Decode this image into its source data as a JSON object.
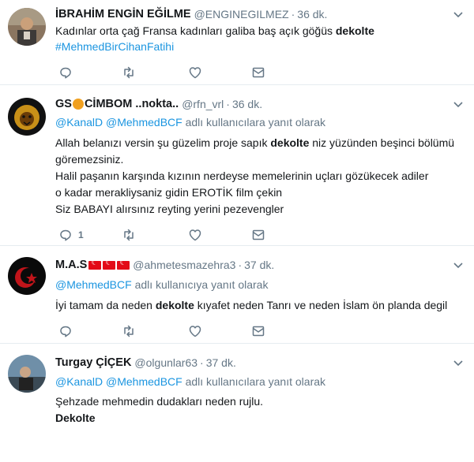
{
  "tweets": [
    {
      "name": "İBRAHİM ENGİN EĞİLME",
      "handle": "@ENGINEGILMEZ",
      "dot": "·",
      "time": "36 dk.",
      "lines": [
        {
          "pre": "Kadınlar orta çağ Fransa kadınları galiba baş açık göğüs ",
          "bold": "dekolte",
          "post": ""
        }
      ],
      "hashtag": "#MehmedBirCihanFatihi",
      "reply_count": ""
    },
    {
      "name_pre": "GS",
      "name_post": "CİMBOM ..nokta..",
      "handle": "@rfn_vrl",
      "dot": "·",
      "time": "36 dk.",
      "reply_to": {
        "mentions": "@KanalD @MehmedBCF",
        "suffix": " adlı kullanıcılara yanıt olarak"
      },
      "lines": [
        {
          "pre": "Allah belanızı versin şu güzelim proje sapık ",
          "bold": "dekolte",
          "post": " niz yüzünden beşinci bölümü"
        },
        {
          "text": "göremezsiniz."
        },
        {
          "text": "Halil paşanın karşında kızının nerdeyse memelerinin uçları gözükecek adiler"
        },
        {
          "text": "o kadar merakliysaniz gidin EROTİK film çekin"
        },
        {
          "text": "Siz BABAYI alırsınız reyting yerini pezevengler"
        }
      ],
      "reply_count": "1"
    },
    {
      "name": "M.A.S",
      "handle": "@ahmetesmazehra3",
      "dot": "·",
      "time": "37 dk.",
      "reply_to": {
        "mentions": "@MehmedBCF",
        "suffix": " adlı kullanıcıya yanıt olarak"
      },
      "lines": [
        {
          "pre": "İyi tamam da neden ",
          "bold": "dekolte",
          "post": " kıyafet neden Tanrı ve neden İslam ön planda degil"
        }
      ],
      "reply_count": ""
    },
    {
      "name": "Turgay ÇİÇEK",
      "handle": "@olgunlar63",
      "dot": "·",
      "time": "37 dk.",
      "reply_to": {
        "mentions": "@KanalD @MehmedBCF",
        "suffix": " adlı kullanıcılara yanıt olarak"
      },
      "lines": [
        {
          "text": "Şehzade mehmedin dudakları neden rujlu."
        }
      ],
      "bold_line": "Dekolte",
      "reply_count": ""
    }
  ],
  "colors": {
    "link": "#1b95e0",
    "muted": "#657786",
    "text": "#14171a",
    "divider": "#e6ecf0"
  },
  "icons": [
    "chevron-down-icon",
    "reply-icon",
    "retweet-icon",
    "like-icon",
    "message-icon"
  ]
}
